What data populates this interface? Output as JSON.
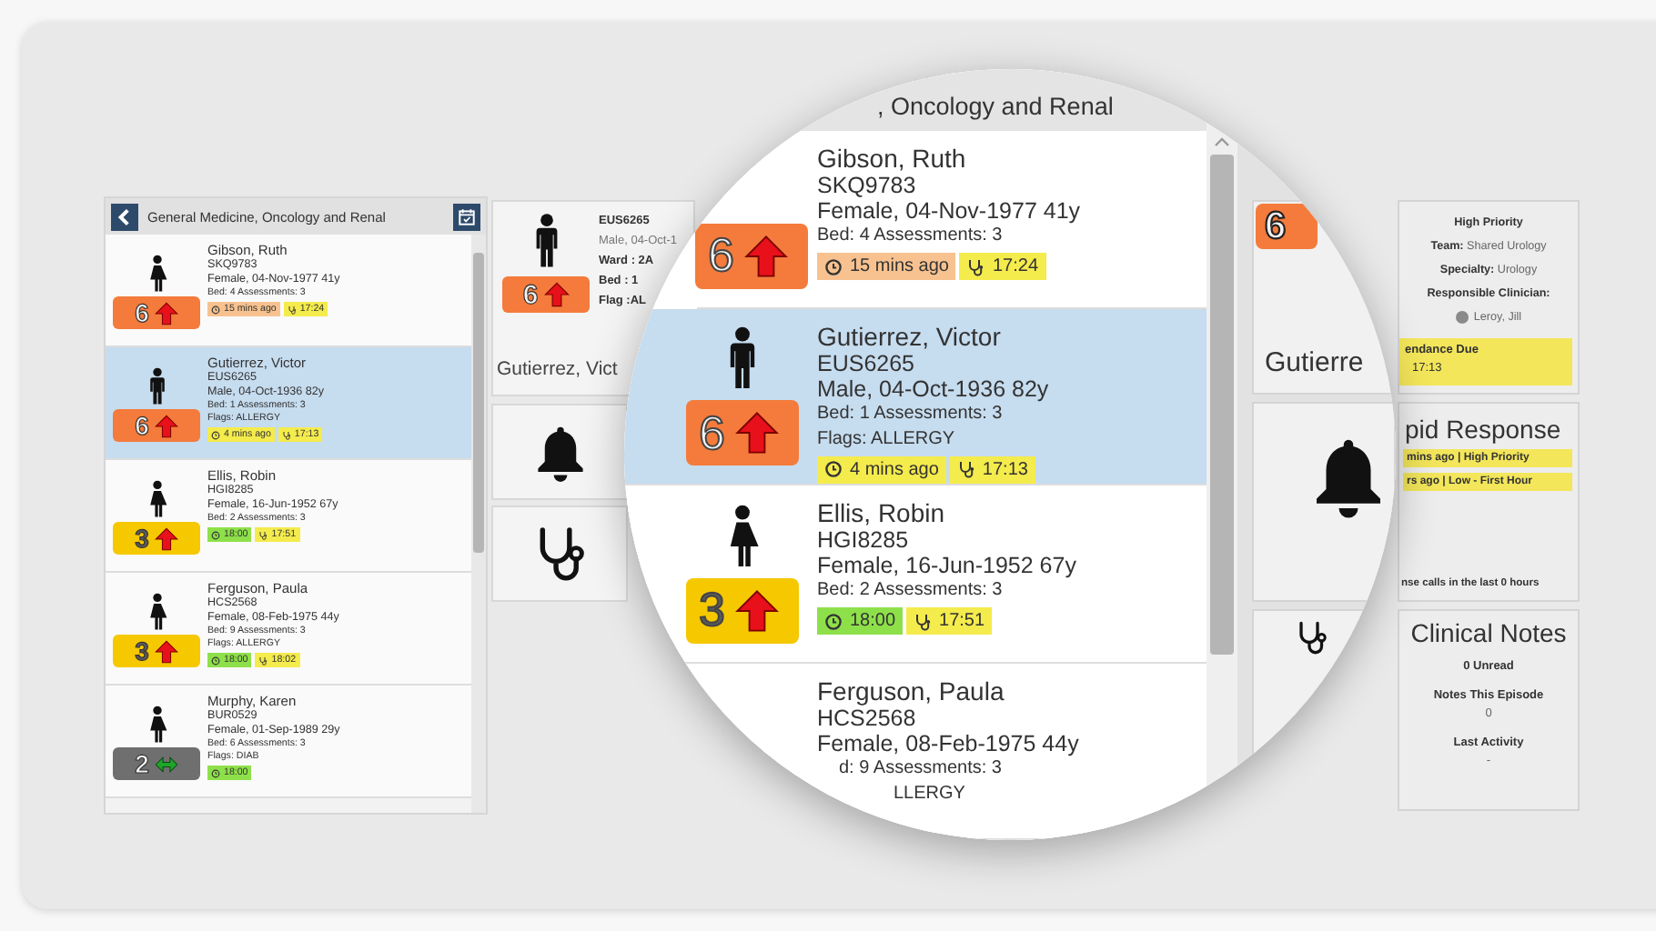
{
  "left_panel": {
    "title": "General Medicine, Oncology and Renal",
    "patients": [
      {
        "name": "Gibson, Ruth",
        "id": "SKQ9783",
        "details": "Female, 04-Nov-1977 41y",
        "bed": "Bed: 4 Assessments: 3",
        "figure": {
          "kind": "female"
        },
        "score": "6",
        "color": "#f47b3b",
        "trend": {
          "kind": "up"
        },
        "selected": false,
        "tags": [
          {
            "kind": "clock",
            "text": "15 mins ago",
            "color": "#f7c28f"
          },
          {
            "kind": "stethoscope",
            "text": "17:24",
            "color": "#f4eb4c"
          }
        ]
      },
      {
        "name": "Gutierrez, Victor",
        "id": "EUS6265",
        "details": "Male, 04-Oct-1936 82y",
        "bed": "Bed: 1 Assessments: 3",
        "flags": "Flags: ALLERGY",
        "figure": {
          "kind": "male"
        },
        "score": "6",
        "color": "#f47b3b",
        "trend": {
          "kind": "up"
        },
        "selected": true,
        "tags": [
          {
            "kind": "clock",
            "text": "4 mins ago",
            "color": "#f4eb4c"
          },
          {
            "kind": "stethoscope",
            "text": "17:13",
            "color": "#f4eb4c"
          }
        ]
      },
      {
        "name": "Ellis, Robin",
        "id": "HGI8285",
        "details": "Female, 16-Jun-1952 67y",
        "bed": "Bed: 2 Assessments: 3",
        "figure": {
          "kind": "female"
        },
        "score": "3",
        "color": "#f5c800",
        "trend": {
          "kind": "up"
        },
        "selected": false,
        "tags": [
          {
            "kind": "clock",
            "text": "18:00",
            "color": "#8ee04a"
          },
          {
            "kind": "stethoscope",
            "text": "17:51",
            "color": "#f4eb4c"
          }
        ]
      },
      {
        "name": "Ferguson, Paula",
        "id": "HCS2568",
        "details": "Female, 08-Feb-1975 44y",
        "bed": "Bed: 9 Assessments: 3",
        "flags": "Flags: ALLERGY",
        "figure": {
          "kind": "female"
        },
        "score": "3",
        "color": "#f5c800",
        "trend": {
          "kind": "up"
        },
        "selected": false,
        "tags": [
          {
            "kind": "clock",
            "text": "18:00",
            "color": "#8ee04a"
          },
          {
            "kind": "stethoscope",
            "text": "18:02",
            "color": "#f4eb4c"
          }
        ]
      },
      {
        "name": "Murphy, Karen",
        "id": "BUR0529",
        "details": "Female, 01-Sep-1989 29y",
        "bed": "Bed: 6 Assessments: 3",
        "flags": "Flags: DIAB",
        "figure": {
          "kind": "female"
        },
        "score": "2",
        "color": "#6f6f6f",
        "trend": {
          "kind": "steady"
        },
        "selected": false,
        "tags": [
          {
            "kind": "clock",
            "text": "18:00",
            "color": "#8ee04a"
          }
        ]
      }
    ]
  },
  "middle_panel": {
    "summary": {
      "figure": {
        "kind": "male"
      },
      "score": "6",
      "color": "#f47b3b",
      "trend": {
        "kind": "up"
      },
      "lines": [
        {
          "text": "EUS6265",
          "bold": true
        },
        {
          "text": "Male, 04-Oct-1",
          "bold": false
        },
        {
          "text": "Ward : 2A",
          "bold": true
        },
        {
          "text": "Bed : 1",
          "bold": true
        },
        {
          "text": "Flag :AL",
          "bold": true
        }
      ],
      "name": "Gutierrez, Vict"
    },
    "tiles": [
      {
        "kind": "bell"
      },
      {
        "kind": "stethoscope"
      }
    ]
  },
  "right_panel": {
    "overview": {
      "lines": [
        {
          "text": "High Priority",
          "bold": true
        },
        {
          "text": "**Team:** Shared Urology",
          "bold": false
        },
        {
          "text": "**Specialty:** Urology",
          "bold": false
        },
        {
          "text": "Responsible Clinician:",
          "bold": true
        }
      ],
      "clinician": "Leroy, Jill",
      "attendance_label": "endance Due",
      "attendance_time": "17:13"
    },
    "rapid_response": {
      "title": "pid Response",
      "alerts": [
        "mins ago | High Priority",
        "rs ago | Low - First Hour"
      ],
      "footer": "nse calls in the last 0 hours"
    },
    "clinical_notes": {
      "title": "Clinical Notes",
      "unread": "0 Unread",
      "episode_label": "Notes This Episode",
      "episode_count": "0",
      "activity_label": "Last Activity",
      "activity_value": "-"
    }
  },
  "magnifier": {
    "title": ", Oncology and Renal",
    "patients": [
      {
        "name": "Gibson, Ruth",
        "id": "SKQ9783",
        "details": "Female, 04-Nov-1977 41y",
        "bed": "Bed: 4 Assessments: 3",
        "score": "6",
        "color": "#f47b3b",
        "trend": {
          "kind": "up"
        },
        "selected": false,
        "tags": [
          {
            "kind": "clock",
            "text": "15 mins ago",
            "color": "#f7c28f"
          },
          {
            "kind": "stethoscope",
            "text": "17:24",
            "color": "#f4eb4c"
          }
        ]
      },
      {
        "name": "Gutierrez, Victor",
        "id": "EUS6265",
        "details": "Male, 04-Oct-1936 82y",
        "bed": "Bed: 1 Assessments: 3",
        "flags": "Flags: ALLERGY",
        "figure": {
          "kind": "male"
        },
        "score": "6",
        "color": "#f47b3b",
        "trend": {
          "kind": "up"
        },
        "selected": true,
        "tags": [
          {
            "kind": "clock",
            "text": "4 mins ago",
            "color": "#f4eb4c"
          },
          {
            "kind": "stethoscope",
            "text": "17:13",
            "color": "#f4eb4c"
          }
        ]
      },
      {
        "name": "Ellis, Robin",
        "id": "HGI8285",
        "details": "Female, 16-Jun-1952 67y",
        "bed": "Bed: 2 Assessments: 3",
        "figure": {
          "kind": "female"
        },
        "score": "3",
        "color": "#f5c800",
        "trend": {
          "kind": "up"
        },
        "selected": false,
        "tags": [
          {
            "kind": "clock",
            "text": "18:00",
            "color": "#8ee04a"
          },
          {
            "kind": "stethoscope",
            "text": "17:51",
            "color": "#f4eb4c"
          }
        ]
      },
      {
        "name": "Ferguson, Paula",
        "id": "HCS2568",
        "details": "Female, 08-Feb-1975 44y",
        "bed": "d: 9 Assessments: 3",
        "flags": "LLERGY",
        "selected": false
      }
    ],
    "side": {
      "score": "6",
      "color": "#f47b3b",
      "name": "Gutierre",
      "tiles": [
        {
          "kind": "bell"
        },
        {
          "kind": "stethoscope"
        }
      ]
    }
  }
}
